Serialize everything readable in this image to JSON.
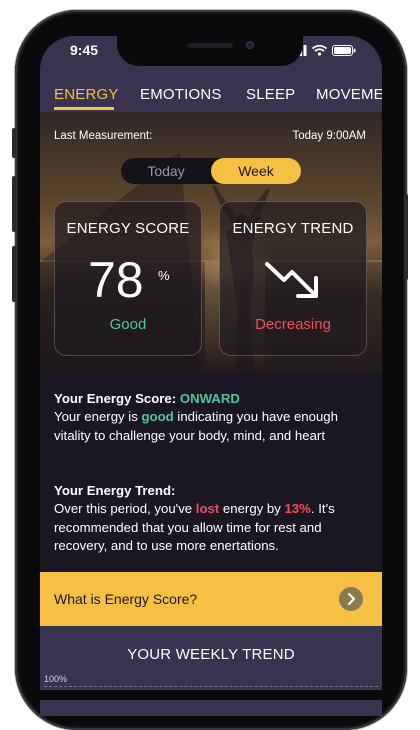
{
  "status_bar": {
    "time": "9:45"
  },
  "tabs": [
    {
      "label": "ENERGY",
      "active": true
    },
    {
      "label": "EMOTIONS",
      "active": false
    },
    {
      "label": "SLEEP",
      "active": false
    },
    {
      "label": "MOVEME",
      "active": false
    }
  ],
  "measurement": {
    "label": "Last Measurement:",
    "value": "Today 9:00AM"
  },
  "period_toggle": {
    "options": [
      "Today",
      "Week"
    ],
    "selected": "Week"
  },
  "score_card": {
    "title": "ENERGY SCORE",
    "value": "78",
    "unit": "%",
    "status": "Good"
  },
  "trend_card": {
    "title": "ENERGY TREND",
    "status": "Decreasing"
  },
  "score_text": {
    "heading": "Your Energy Score:",
    "tag": "ONWARD",
    "body_1": "Your energy is",
    "highlight": "good",
    "body_2": "indicating you have enough vitality to challenge your body, mind, and heart"
  },
  "trend_text": {
    "heading": "Your Energy Trend:",
    "body_1": "Over this period, you've",
    "highlight": "lost",
    "body_2": "energy by",
    "percent": "13%",
    "body_3": ". It's recommended that you allow time for rest and recovery, and to use more enertations."
  },
  "faq": {
    "label": "What is Energy Score?"
  },
  "weekly_trend": {
    "title": "YOUR WEEKLY TREND",
    "axis_label": "100%"
  },
  "colors": {
    "accent": "#f5c043",
    "good": "#55c49a",
    "bad": "#ef4d5e",
    "bar": "#3a3350",
    "background": "#1a1722"
  }
}
